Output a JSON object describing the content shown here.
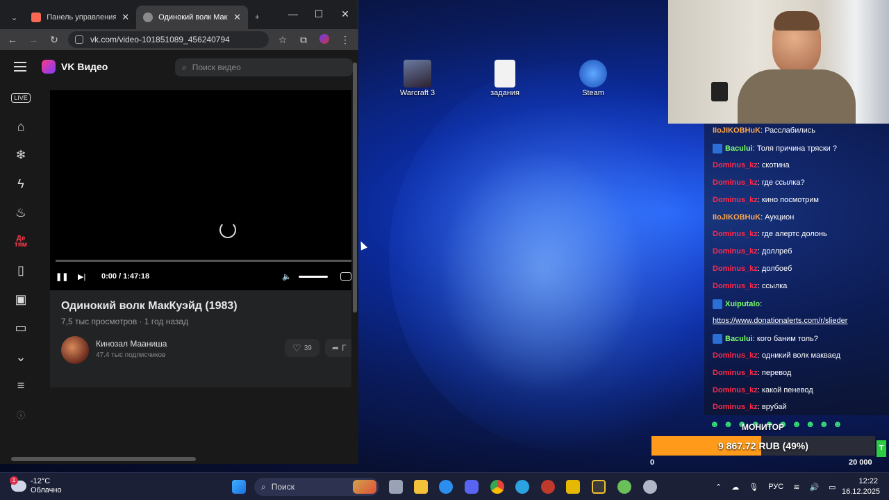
{
  "browser": {
    "tabs": [
      {
        "label": "Панель управления",
        "close": "✕"
      },
      {
        "label": "Одинокий волк Мак",
        "close": "✕"
      }
    ],
    "new_tab": "+",
    "minimize": "—",
    "maximize": "☐",
    "close": "✕",
    "url": "vk.com/video-101851089_456240794"
  },
  "vk": {
    "brand": "VK Видео",
    "search_placeholder": "Поиск видео",
    "sidebar_live": "LIVE",
    "sidebar_kids": "Де тям",
    "player": {
      "time": "0:00 / 1:47:18",
      "progress": 0
    },
    "video": {
      "title": "Одинокий волк МакКуэйд (1983)",
      "views": "7,5 тыс просмотров",
      "dot": "·",
      "age": "1 год назад",
      "channel": "Кинозал Мааниша",
      "subscribers": "47.4 тыс подписчиков",
      "likes": "39",
      "share": "Г"
    }
  },
  "desktop_icons": [
    {
      "label": "Warcraft 3"
    },
    {
      "label": "задания"
    },
    {
      "label": "Steam"
    }
  ],
  "chat": [
    {
      "nick": "IIoJIKOBHuK",
      "color": "#ffa84a",
      "text": ": Расслабились",
      "badge": false
    },
    {
      "nick": "Bacului",
      "color": "#7dff6a",
      "text": ": Толя причина тряски ?",
      "badge": true
    },
    {
      "nick": "Dominus_kz",
      "color": "#ff2a4a",
      "text": ": скотина",
      "badge": false
    },
    {
      "nick": "Dominus_kz",
      "color": "#ff2a4a",
      "text": ": где ссылка?",
      "badge": false
    },
    {
      "nick": "Dominus_kz",
      "color": "#ff2a4a",
      "text": ": кино посмотрим",
      "badge": false
    },
    {
      "nick": "IIoJIKOBHuK",
      "color": "#ffa84a",
      "text": ": Аукцион",
      "badge": false
    },
    {
      "nick": "Dominus_kz",
      "color": "#ff2a4a",
      "text": ": где алертс долонь",
      "badge": false
    },
    {
      "nick": "Dominus_kz",
      "color": "#ff2a4a",
      "text": ": доллреб",
      "badge": false
    },
    {
      "nick": "Dominus_kz",
      "color": "#ff2a4a",
      "text": ": долбоеб",
      "badge": false
    },
    {
      "nick": "Dominus_kz",
      "color": "#ff2a4a",
      "text": ": ссылка",
      "badge": false
    },
    {
      "nick": "Xuiputalo",
      "color": "#7dff6a",
      "text": ":",
      "badge": true
    },
    {
      "link": "https://www.donationalerts.com/r/slieder"
    },
    {
      "nick": "Bacului",
      "color": "#7dff6a",
      "text": ": кого баним толь?",
      "badge": true
    },
    {
      "nick": "Dominus_kz",
      "color": "#ff2a4a",
      "text": ": одникий волк макваед",
      "badge": false
    },
    {
      "nick": "Dominus_kz",
      "color": "#ff2a4a",
      "text": ": перевод",
      "badge": false
    },
    {
      "nick": "Dominus_kz",
      "color": "#ff2a4a",
      "text": ": какой пеневод",
      "badge": false
    },
    {
      "nick": "Dominus_kz",
      "color": "#ff2a4a",
      "text": ": врубай",
      "badge": false
    }
  ],
  "donation_goal": {
    "label": "МОНИТОР",
    "amount_text": "9 867.72 RUB (49%)",
    "fraction": 0.49,
    "min": "0",
    "max": "20 000",
    "side_text": "T"
  },
  "taskbar": {
    "weather_temp": "-12°C",
    "weather_desc": "Облачно",
    "weather_badge": "1",
    "search_label": "Поиск",
    "language": "РУС",
    "time": "12:22",
    "date": "16.12.2025"
  }
}
